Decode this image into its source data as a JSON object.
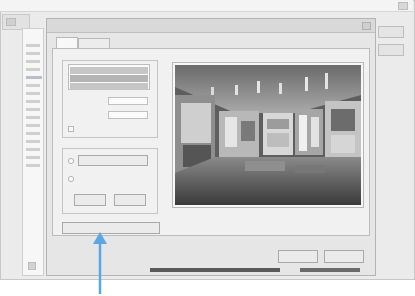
{
  "outer_window": {
    "title": "",
    "close_icon": "close-icon"
  },
  "left_panel": {
    "toolbar_icon": "grid-icon",
    "tree_item_count_shown": 14
  },
  "dialog": {
    "title": "",
    "close_icon": "close-icon",
    "tabs": [
      {
        "label": "",
        "active": true
      },
      {
        "label": "",
        "active": false
      }
    ],
    "left_group": {
      "label": "",
      "list_items": [
        "",
        "",
        ""
      ],
      "field1_label": "",
      "field1_value": "",
      "field2_label": "",
      "field2_value": "",
      "checkbox_label": ""
    },
    "lower_group": {
      "label": "",
      "radio1_label": "",
      "radio2_label": "",
      "button_left_label": "",
      "button_right_label": ""
    },
    "wide_button_label": "",
    "preview": {
      "label": "",
      "image_description": "camera-view-icon"
    },
    "ok_label": "",
    "cancel_label": ""
  },
  "annotation": {
    "arrow_icon": "arrow-up-icon",
    "arrow_color": "#5aa7e6"
  }
}
